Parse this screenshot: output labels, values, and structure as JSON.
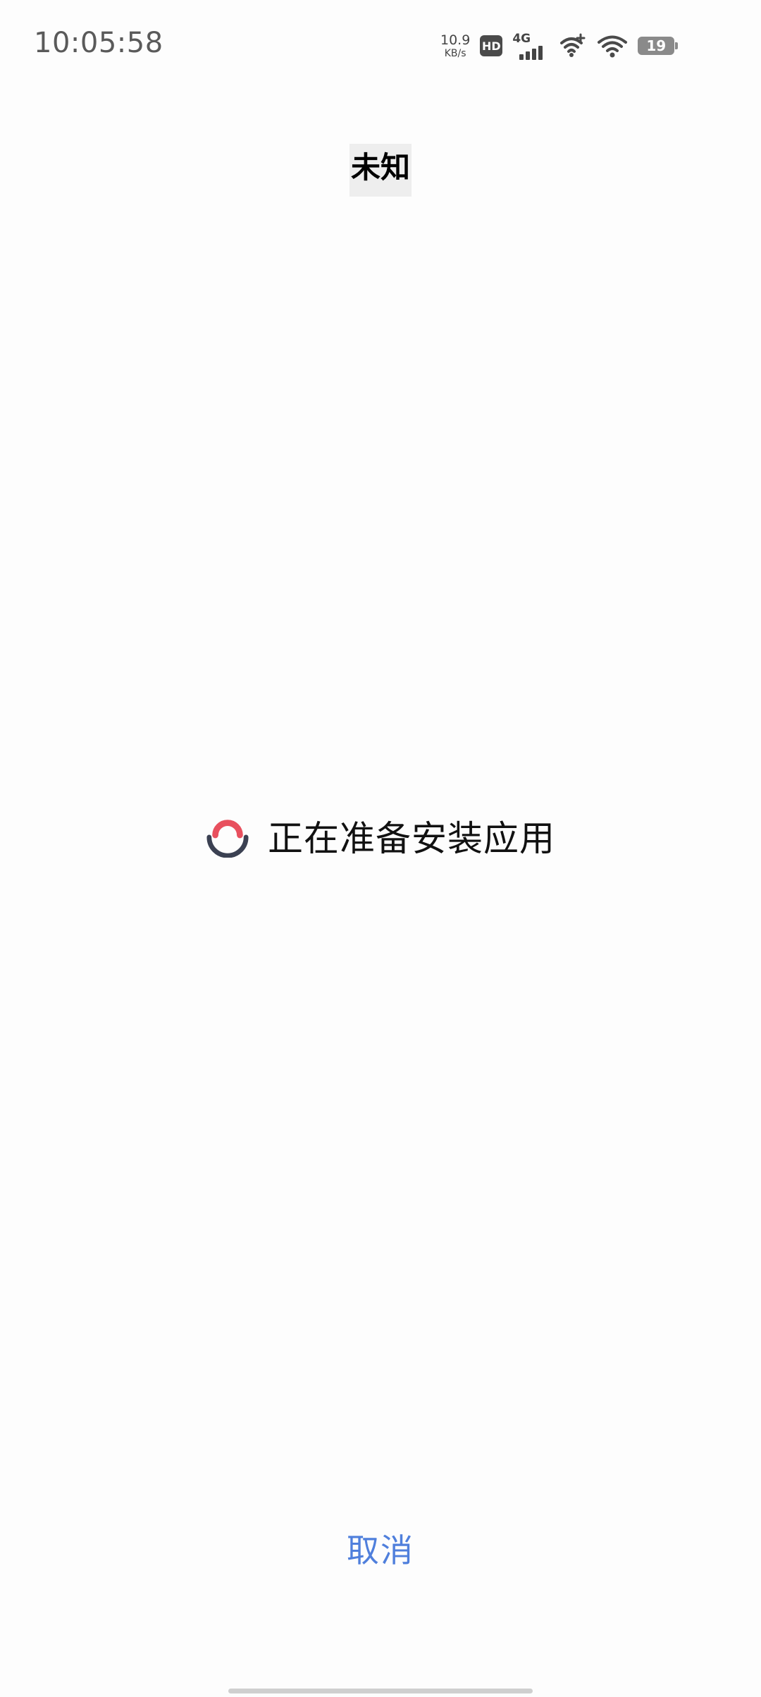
{
  "status_bar": {
    "time": "10:05:58",
    "net_speed_value": "10.9",
    "net_speed_unit": "KB/s",
    "hd_label": "HD",
    "network_type": "4G",
    "battery_level": "19"
  },
  "header": {
    "title": "未知"
  },
  "main": {
    "status_text": "正在准备安装应用",
    "spinner_colors": {
      "top": "#e8505e",
      "bottom": "#3b4152"
    }
  },
  "footer": {
    "cancel_label": "取消",
    "cancel_color": "#4f7fdc"
  }
}
